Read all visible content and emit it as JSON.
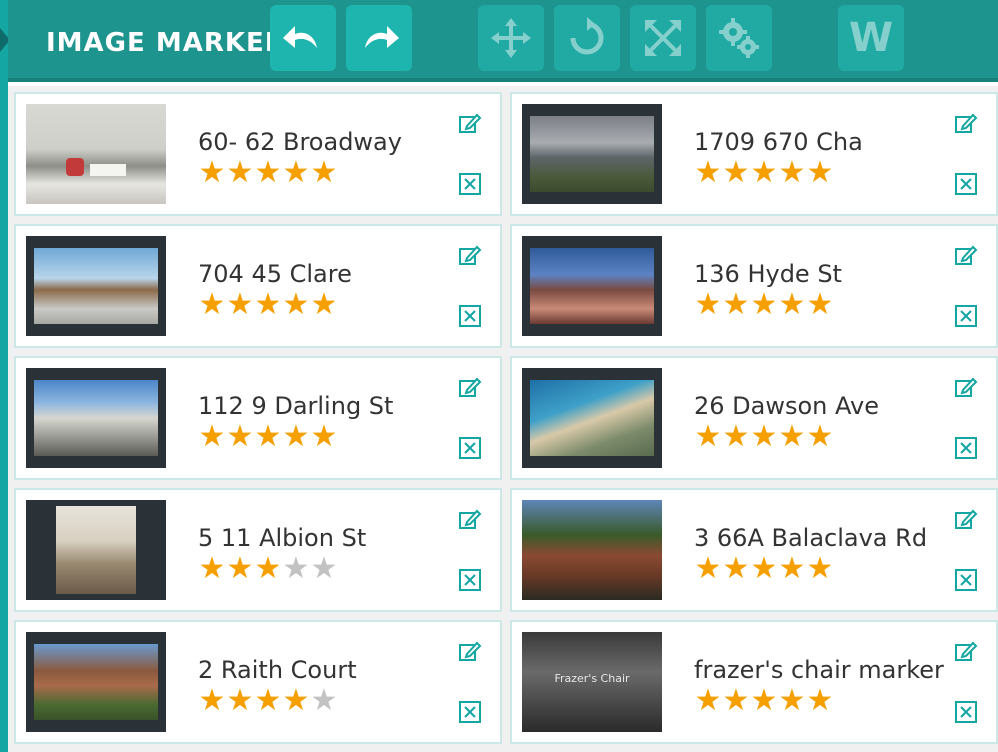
{
  "toolbar": {
    "title": "IMAGE MARKER",
    "buttons": [
      {
        "name": "undo",
        "icon": "undo-arrow-icon",
        "state": "enabled"
      },
      {
        "name": "redo",
        "icon": "redo-arrow-icon",
        "state": "enabled"
      },
      {
        "name": "move",
        "icon": "move-arrows-icon",
        "state": "disabled"
      },
      {
        "name": "rotate",
        "icon": "rotate-icon",
        "state": "disabled"
      },
      {
        "name": "expand",
        "icon": "expand-icon",
        "state": "disabled"
      },
      {
        "name": "settings",
        "icon": "gears-icon",
        "state": "disabled"
      },
      {
        "name": "w",
        "label": "W",
        "state": "disabled"
      }
    ]
  },
  "colors": {
    "toolbar": "#1e948f",
    "accent": "#14a6a2",
    "star": "#f5a000",
    "star_off": "#c2c2c2",
    "card_border": "#cce8e6"
  },
  "properties": [
    {
      "title": "60- 62 Broadway",
      "rating": 5,
      "thumb": "interior-living-room"
    },
    {
      "title": "1709 670 Cha",
      "rating": 5,
      "thumb": "rooftop-city-view"
    },
    {
      "title": "704 45 Clare",
      "rating": 5,
      "thumb": "modern-building-exterior"
    },
    {
      "title": "136 Hyde St",
      "rating": 5,
      "thumb": "house-facade"
    },
    {
      "title": "112 9 Darling St",
      "rating": 5,
      "thumb": "apartment-block"
    },
    {
      "title": "26 Dawson Ave",
      "rating": 5,
      "thumb": "aerial-coast"
    },
    {
      "title": "5 11 Albion St",
      "rating": 3,
      "thumb": "interior-lounge"
    },
    {
      "title": "3 66A Balaclava Rd",
      "rating": 5,
      "thumb": "tree-lined-house"
    },
    {
      "title": "2 Raith Court",
      "rating": 4,
      "thumb": "brick-house"
    },
    {
      "title": "frazer's chair marker",
      "rating": 5,
      "thumb": "chair-display",
      "thumb_caption": "Frazer's Chair"
    }
  ]
}
